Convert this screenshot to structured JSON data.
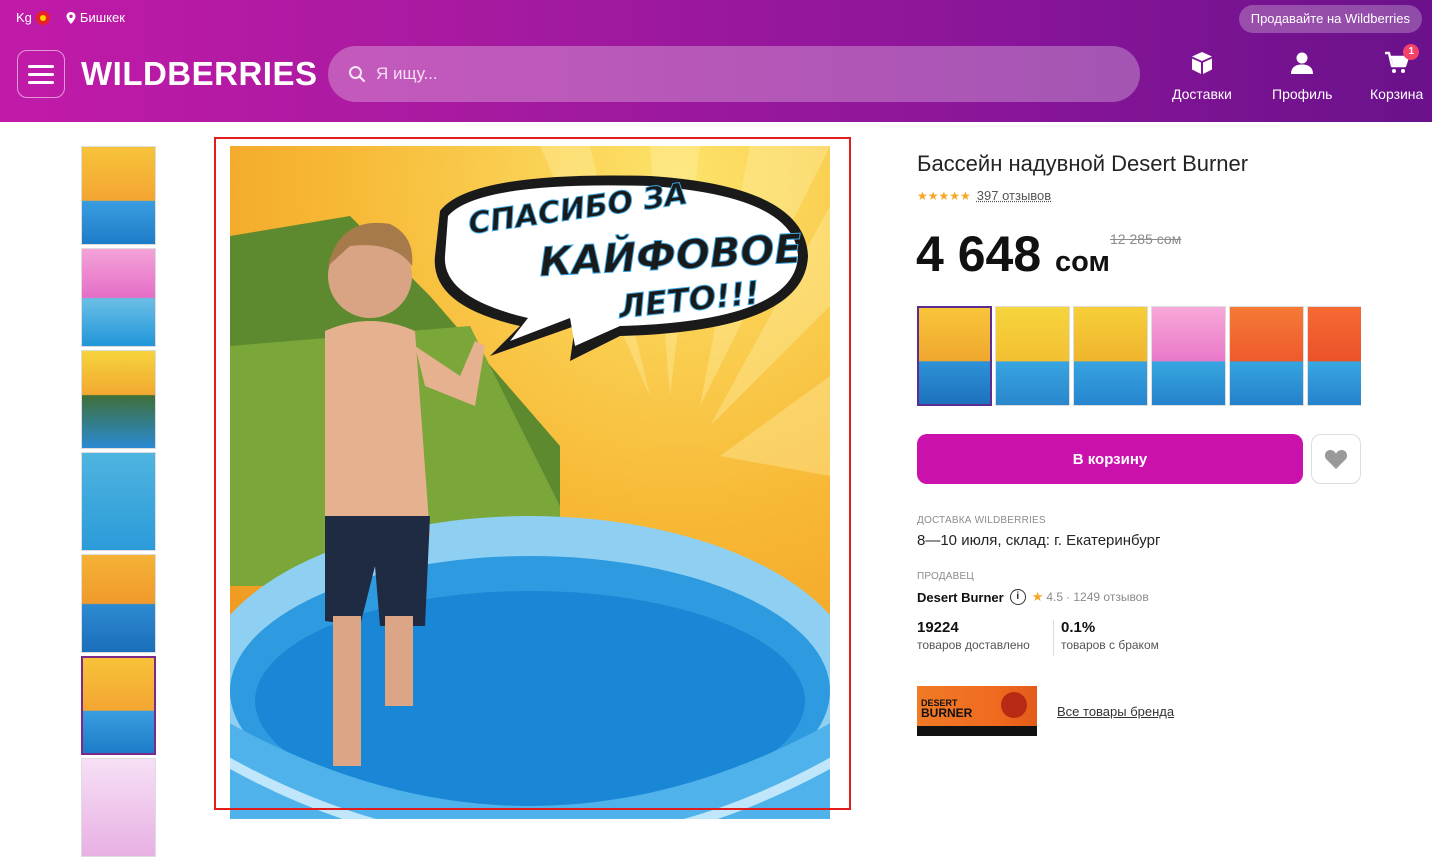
{
  "header": {
    "country": "Kg",
    "city": "Бишкек",
    "sell_label": "Продавайте на Wildberries",
    "logo": "WILDBERRIES",
    "search_placeholder": "Я ищу...",
    "nav": {
      "delivery": "Доставки",
      "profile": "Профиль",
      "cart": "Корзина",
      "cart_count": "1"
    }
  },
  "product": {
    "title": "Бассейн надувной  Desert Burner",
    "stars": "★★★★★",
    "reviews": "397 отзывов",
    "price": "4 648",
    "currency": "сом",
    "old_price": "12 285 сом"
  },
  "main_image": {
    "bubble_line1": "СПАСИБО ЗА",
    "bubble_line2": "КАЙФОВОЕ",
    "bubble_line3": "ЛЕТО!!!"
  },
  "actions": {
    "cart_button": "В корзину"
  },
  "delivery": {
    "label": "Доставка Wildberries",
    "text": "8—10 июля, склад: г. Екатеринбург"
  },
  "seller": {
    "label": "Продавец",
    "name": "Desert Burner",
    "rating": "4.5",
    "rating_reviews": "· 1249 отзывов",
    "delivered_count": "19224",
    "delivered_label": "товаров доставлено",
    "defect_rate": "0.1%",
    "defect_label": "товаров с браком"
  },
  "brand": {
    "logo_line1": "DESERT",
    "logo_line2": "BURNER",
    "link": "Все товары бренда"
  },
  "colors": {
    "accent": "#cb11ab",
    "header_start": "#c11aa8",
    "header_end": "#6a118b",
    "star": "#f5a623",
    "frame": "#e21d1d"
  }
}
